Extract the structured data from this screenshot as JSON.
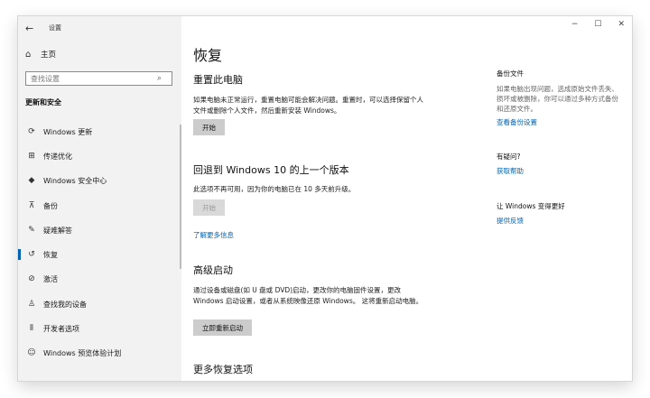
{
  "window": {
    "title": "设置",
    "controls": {
      "minimize": "−",
      "maximize": "☐",
      "close": "✕"
    }
  },
  "sidebar": {
    "home_label": "主页",
    "search_placeholder": "查找设置",
    "section_title": "更新和安全",
    "items": [
      {
        "label": "Windows 更新",
        "icon": "sync-icon"
      },
      {
        "label": "传递优化",
        "icon": "delivery-optimization-icon"
      },
      {
        "label": "Windows 安全中心",
        "icon": "shield-icon"
      },
      {
        "label": "备份",
        "icon": "backup-icon"
      },
      {
        "label": "疑难解答",
        "icon": "wrench-icon"
      },
      {
        "label": "恢复",
        "icon": "recovery-icon",
        "selected": true
      },
      {
        "label": "激活",
        "icon": "check-circle-icon"
      },
      {
        "label": "查找我的设备",
        "icon": "find-device-icon"
      },
      {
        "label": "开发者选项",
        "icon": "developer-icon"
      },
      {
        "label": "Windows 预览体验计划",
        "icon": "insider-icon"
      }
    ]
  },
  "main": {
    "title": "恢复",
    "reset": {
      "heading": "重置此电脑",
      "desc": "如果电脑未正常运行，重置电脑可能会解决问题。重置时，可以选择保留个人文件或删除个人文件，然后重新安装 Windows。",
      "button": "开始"
    },
    "rollback": {
      "heading": "回退到 Windows 10 的上一个版本",
      "desc": "此选项不再可用，因为你的电脑已在 10 多天前升级。",
      "button": "开始",
      "link": "了解更多信息"
    },
    "advanced": {
      "heading": "高级启动",
      "desc": "通过设备或磁盘(如 U 盘或 DVD)启动，更改你的电脑固件设置，更改 Windows 启动设置，或者从系统映像还原 Windows。 这将重新启动电脑。",
      "button": "立即重新启动"
    },
    "more": {
      "heading": "更多恢复选项"
    }
  },
  "right_panel": {
    "backup": {
      "heading": "备份文件",
      "text": "如果电脑出现问题，选成原始文件丢失、损坏或被删除，你可以通过多种方式备份和还原文件。",
      "link": "查看备份设置"
    },
    "help": {
      "heading": "有疑问?",
      "link": "获取帮助"
    },
    "improve": {
      "heading": "让 Windows 变得更好",
      "link": "提供反馈"
    }
  }
}
